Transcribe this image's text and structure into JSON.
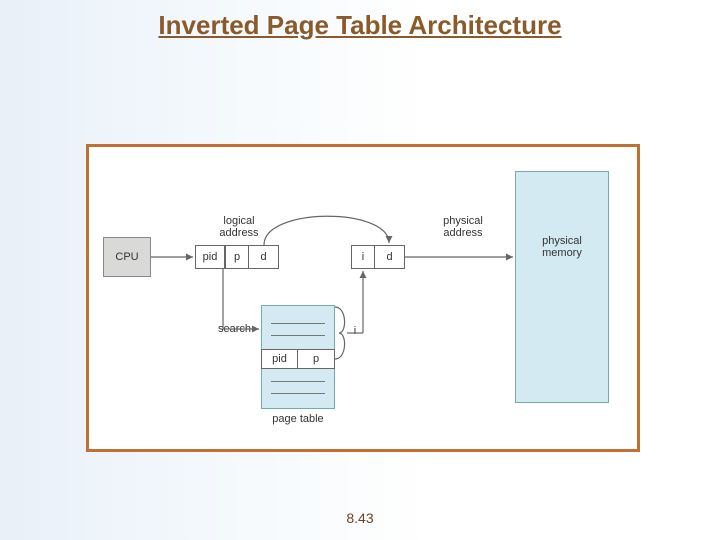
{
  "title": "Inverted Page Table Architecture",
  "footer": "8.43",
  "boxes": {
    "cpu": "CPU",
    "pid1": "pid",
    "p1": "p",
    "d1": "d",
    "i2": "i",
    "d2": "d",
    "tbl_pid": "pid",
    "tbl_p": "p"
  },
  "labels": {
    "logical": "logical\naddress",
    "physical": "physical\naddress",
    "search": "search",
    "i": "i",
    "pagetable": "page table",
    "memory": "physical\nmemory"
  }
}
